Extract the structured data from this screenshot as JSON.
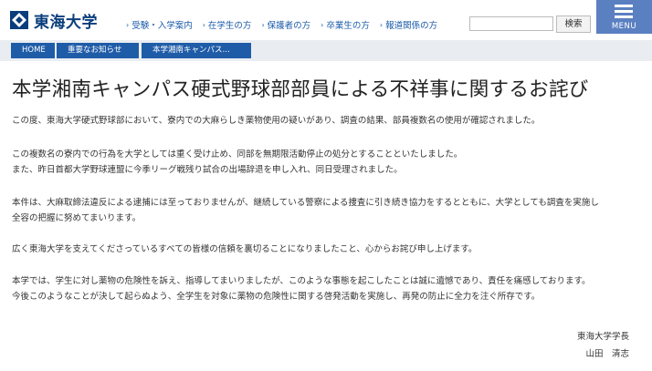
{
  "header": {
    "logo_text": "東海大学",
    "nav": [
      {
        "label": "受験・入学案内"
      },
      {
        "label": "在学生の方"
      },
      {
        "label": "保護者の方"
      },
      {
        "label": "卒業生の方"
      },
      {
        "label": "報道関係の方"
      }
    ],
    "search": {
      "placeholder": "",
      "button_label": "検索"
    },
    "menu_label": "MENU"
  },
  "breadcrumb": {
    "home": "HOME",
    "news": "重要なお知らせ",
    "current": "本学湘南キャンパス…"
  },
  "article": {
    "title": "本学湘南キャンパス硬式野球部部員による不祥事に関するお詫び",
    "paragraphs": [
      {
        "lines": [
          "この度、東海大学硬式野球部において、寮内での大麻らしき薬物使用の疑いがあり、調査の結果、部員複数名の使用が確認されました。"
        ]
      },
      {
        "lines": [
          "この複数名の寮内での行為を大学としては重く受け止め、同部を無期限活動停止の処分とすることといたしました。",
          "また、昨日首都大学野球連盟に今季リーグ戦残り試合の出場辞退を申し入れ、同日受理されました。"
        ]
      },
      {
        "lines": [
          "本件は、大麻取締法違反による逮捕には至っておりませんが、継続している警察による捜査に引き続き協力をするとともに、大学としても調査を実施し",
          "全容の把握に努めてまいります。"
        ]
      },
      {
        "lines": [
          "広く東海大学を支えてくださっているすべての皆様の信頼を裏切ることになりましたこと、心からお詫び申し上げます。"
        ]
      },
      {
        "lines": [
          "本学では、学生に対し薬物の危険性を訴え、指導してまいりましたが、このような事態を起こしたことは誠に遺憾であり、責任を痛感しております。",
          "今後このようなことが決して起らぬよう、全学生を対象に薬物の危険性に関する啓発活動を実施し、再発の防止に全力を注ぐ所存です。"
        ]
      }
    ],
    "signature": {
      "position": "東海大学学長",
      "name": "山田　清志"
    }
  }
}
